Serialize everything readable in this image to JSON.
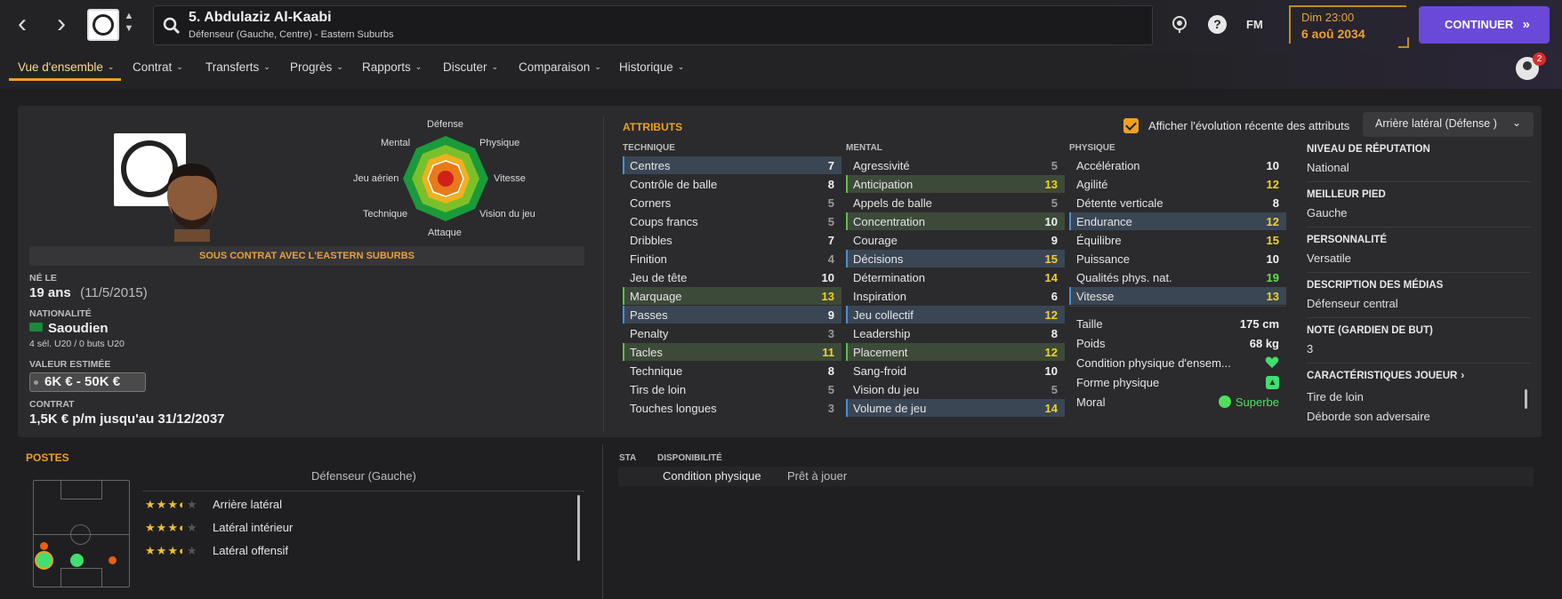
{
  "header": {
    "back_glyph": "‹",
    "forward_glyph": "›",
    "player_title": "5. Abdulaziz Al-Kaabi",
    "player_subtitle": "Défenseur (Gauche, Centre) - Eastern Suburbs",
    "fm_label": "FM",
    "help_glyph": "?",
    "date_time": "Dim 23:00",
    "date_day": "6 aoû 2034",
    "continue_label": "CONTINUER",
    "continue_chev": "»",
    "notification_count": "2"
  },
  "tabs": [
    {
      "label": "Vue d'ensemble"
    },
    {
      "label": "Contrat"
    },
    {
      "label": "Transferts"
    },
    {
      "label": "Progrès"
    },
    {
      "label": "Rapports"
    },
    {
      "label": "Discuter"
    },
    {
      "label": "Comparaison"
    },
    {
      "label": "Historique"
    }
  ],
  "profile": {
    "contract_banner": "SOUS CONTRAT AVEC L'EASTERN SUBURBS",
    "born_label": "NÉ LE",
    "age": "19 ans",
    "birth_date": "(11/5/2015)",
    "nationality_label": "NATIONALITÉ",
    "nationality": "Saoudien",
    "caps": "4 sél. U20 / 0 buts U20",
    "value_label": "VALEUR ESTIMÉE",
    "value": "6K € - 50K €",
    "contract_label": "CONTRAT",
    "contract": "1,5K € p/m jusqu'au 31/12/2037"
  },
  "radar": {
    "top": "Défense",
    "top_right": "Physique",
    "right": "Vitesse",
    "bottom_right": "Vision du jeu",
    "bottom": "Attaque",
    "bottom_left": "Technique",
    "left": "Jeu aérien",
    "top_left": "Mental"
  },
  "attributes": {
    "title": "ATTRIBUTS",
    "show_evolution_label": "Afficher l'évolution récente des attributs",
    "role_select": "Arrière latéral (Défense )",
    "technique_header": "TECHNIQUE",
    "mental_header": "MENTAL",
    "physique_header": "PHYSIQUE",
    "technique": [
      {
        "name": "Centres",
        "value": "7"
      },
      {
        "name": "Contrôle de balle",
        "value": "8"
      },
      {
        "name": "Corners",
        "value": "5"
      },
      {
        "name": "Coups francs",
        "value": "5"
      },
      {
        "name": "Dribbles",
        "value": "7"
      },
      {
        "name": "Finition",
        "value": "4"
      },
      {
        "name": "Jeu de tête",
        "value": "10"
      },
      {
        "name": "Marquage",
        "value": "13"
      },
      {
        "name": "Passes",
        "value": "9"
      },
      {
        "name": "Penalty",
        "value": "3"
      },
      {
        "name": "Tacles",
        "value": "11"
      },
      {
        "name": "Technique",
        "value": "8"
      },
      {
        "name": "Tirs de loin",
        "value": "5"
      },
      {
        "name": "Touches longues",
        "value": "3"
      }
    ],
    "mental": [
      {
        "name": "Agressivité",
        "value": "5"
      },
      {
        "name": "Anticipation",
        "value": "13"
      },
      {
        "name": "Appels de balle",
        "value": "5"
      },
      {
        "name": "Concentration",
        "value": "10"
      },
      {
        "name": "Courage",
        "value": "9"
      },
      {
        "name": "Décisions",
        "value": "15"
      },
      {
        "name": "Détermination",
        "value": "14"
      },
      {
        "name": "Inspiration",
        "value": "6"
      },
      {
        "name": "Jeu collectif",
        "value": "12"
      },
      {
        "name": "Leadership",
        "value": "8"
      },
      {
        "name": "Placement",
        "value": "12"
      },
      {
        "name": "Sang-froid",
        "value": "10"
      },
      {
        "name": "Vision du jeu",
        "value": "5"
      },
      {
        "name": "Volume de jeu",
        "value": "14"
      }
    ],
    "physique": [
      {
        "name": "Accélération",
        "value": "10"
      },
      {
        "name": "Agilité",
        "value": "12"
      },
      {
        "name": "Détente verticale",
        "value": "8"
      },
      {
        "name": "Endurance",
        "value": "12"
      },
      {
        "name": "Équilibre",
        "value": "15"
      },
      {
        "name": "Puissance",
        "value": "10"
      },
      {
        "name": "Qualités phys. nat.",
        "value": "19"
      },
      {
        "name": "Vitesse",
        "value": "13"
      }
    ],
    "body": [
      {
        "name": "Taille",
        "value": "175 cm"
      },
      {
        "name": "Poids",
        "value": "68 kg"
      },
      {
        "name": "Condition physique d'ensem...",
        "value": ""
      },
      {
        "name": "Forme physique",
        "value": ""
      },
      {
        "name": "Moral",
        "value": "Superbe"
      }
    ]
  },
  "side_info": {
    "reputation_label": "NIVEAU DE RÉPUTATION",
    "reputation": "National",
    "foot_label": "MEILLEUR PIED",
    "foot": "Gauche",
    "personality_label": "PERSONNALITÉ",
    "personality": "Versatile",
    "media_label": "DESCRIPTION DES MÉDIAS",
    "media": "Défenseur central",
    "gk_label": "NOTE (GARDIEN DE BUT)",
    "gk": "3",
    "traits_label": "CARACTÉRISTIQUES JOUEUR",
    "trait1": "Tire de loin",
    "trait2": "Déborde son adversaire"
  },
  "positions": {
    "title": "POSTES",
    "main_position": "Défenseur (Gauche)",
    "roles": [
      {
        "name": "Arrière latéral",
        "stars": 3.5
      },
      {
        "name": "Latéral intérieur",
        "stars": 3.5
      },
      {
        "name": "Latéral offensif",
        "stars": 3.5
      }
    ]
  },
  "availability": {
    "sta_label": "STA",
    "dispo_label": "DISPONIBILITÉ",
    "condition_label": "Condition physique",
    "condition_value": "Prêt à jouer"
  },
  "colors": {
    "accent": "#f0a020",
    "continue": "#6a49d8",
    "attr_yellow": "#f4d12a",
    "attr_green": "#5fe34a"
  }
}
